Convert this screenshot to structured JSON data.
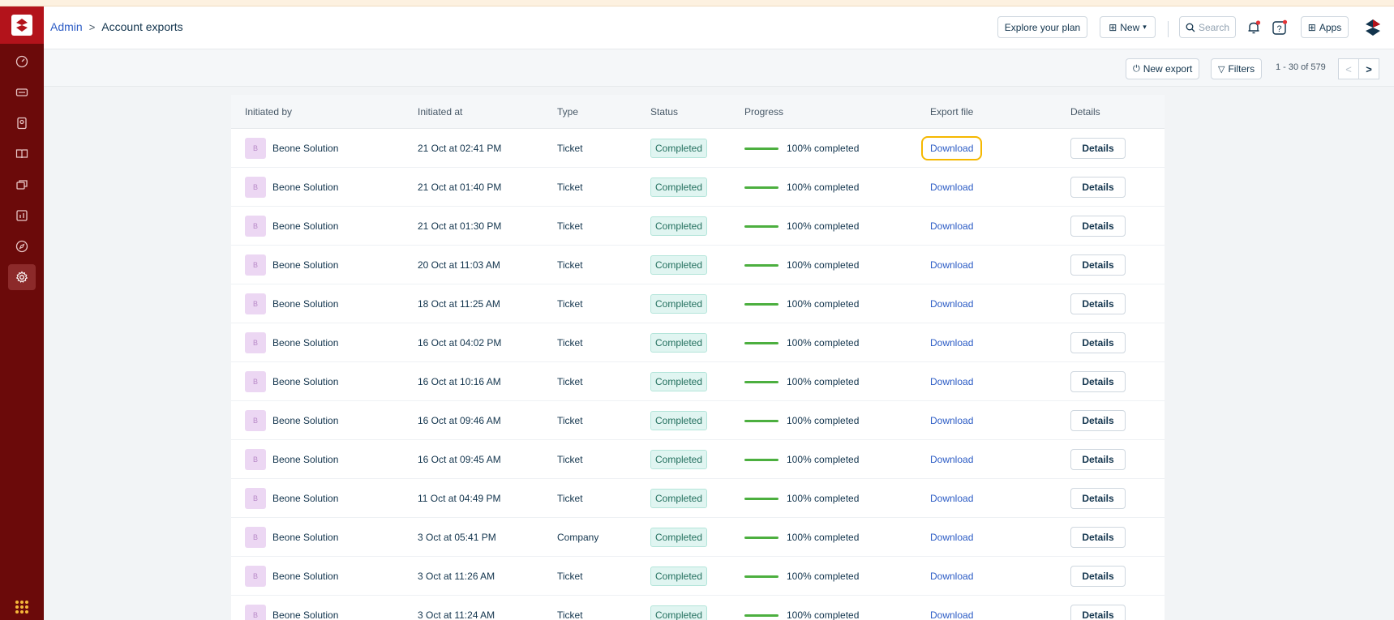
{
  "breadcrumb": {
    "parent": "Admin",
    "separator": ">",
    "current": "Account exports"
  },
  "header": {
    "explore_label": "Explore your plan",
    "new_label": "New",
    "search_placeholder": "Search",
    "apps_label": "Apps"
  },
  "toolbar": {
    "new_export_label": "New export",
    "filters_label": "Filters",
    "pagination": "1 - 30 of 579",
    "prev": "<",
    "next": ">"
  },
  "table": {
    "columns": [
      "Initiated by",
      "Initiated at",
      "Type",
      "Status",
      "Progress",
      "Export file",
      "Details"
    ],
    "rows": [
      {
        "initial": "B",
        "user": "Beone Solution",
        "at": "21 Oct at 02:41 PM",
        "type": "Ticket",
        "status": "Completed",
        "progress": "100% completed",
        "file": "Download",
        "details": "Details"
      },
      {
        "initial": "B",
        "user": "Beone Solution",
        "at": "21 Oct at 01:40 PM",
        "type": "Ticket",
        "status": "Completed",
        "progress": "100% completed",
        "file": "Download",
        "details": "Details"
      },
      {
        "initial": "B",
        "user": "Beone Solution",
        "at": "21 Oct at 01:30 PM",
        "type": "Ticket",
        "status": "Completed",
        "progress": "100% completed",
        "file": "Download",
        "details": "Details"
      },
      {
        "initial": "B",
        "user": "Beone Solution",
        "at": "20 Oct at 11:03 AM",
        "type": "Ticket",
        "status": "Completed",
        "progress": "100% completed",
        "file": "Download",
        "details": "Details"
      },
      {
        "initial": "B",
        "user": "Beone Solution",
        "at": "18 Oct at 11:25 AM",
        "type": "Ticket",
        "status": "Completed",
        "progress": "100% completed",
        "file": "Download",
        "details": "Details"
      },
      {
        "initial": "B",
        "user": "Beone Solution",
        "at": "16 Oct at 04:02 PM",
        "type": "Ticket",
        "status": "Completed",
        "progress": "100% completed",
        "file": "Download",
        "details": "Details"
      },
      {
        "initial": "B",
        "user": "Beone Solution",
        "at": "16 Oct at 10:16 AM",
        "type": "Ticket",
        "status": "Completed",
        "progress": "100% completed",
        "file": "Download",
        "details": "Details"
      },
      {
        "initial": "B",
        "user": "Beone Solution",
        "at": "16 Oct at 09:46 AM",
        "type": "Ticket",
        "status": "Completed",
        "progress": "100% completed",
        "file": "Download",
        "details": "Details"
      },
      {
        "initial": "B",
        "user": "Beone Solution",
        "at": "16 Oct at 09:45 AM",
        "type": "Ticket",
        "status": "Completed",
        "progress": "100% completed",
        "file": "Download",
        "details": "Details"
      },
      {
        "initial": "B",
        "user": "Beone Solution",
        "at": "11 Oct at 04:49 PM",
        "type": "Ticket",
        "status": "Completed",
        "progress": "100% completed",
        "file": "Download",
        "details": "Details"
      },
      {
        "initial": "B",
        "user": "Beone Solution",
        "at": "3 Oct at 05:41 PM",
        "type": "Company",
        "status": "Completed",
        "progress": "100% completed",
        "file": "Download",
        "details": "Details"
      },
      {
        "initial": "B",
        "user": "Beone Solution",
        "at": "3 Oct at 11:26 AM",
        "type": "Ticket",
        "status": "Completed",
        "progress": "100% completed",
        "file": "Download",
        "details": "Details"
      },
      {
        "initial": "B",
        "user": "Beone Solution",
        "at": "3 Oct at 11:24 AM",
        "type": "Ticket",
        "status": "Completed",
        "progress": "100% completed",
        "file": "Download",
        "details": "Details"
      }
    ]
  },
  "colors": {
    "sidebar": "#6b0a0a",
    "brand": "#b3131b",
    "link": "#2c5cc5",
    "progress": "#4caf3f",
    "focus_ring": "#f5b800"
  },
  "sidebar_icons": [
    "dashboard-icon",
    "tickets-icon",
    "contacts-icon",
    "solutions-icon",
    "assets-icon",
    "reports-icon",
    "discover-icon",
    "settings-icon"
  ]
}
